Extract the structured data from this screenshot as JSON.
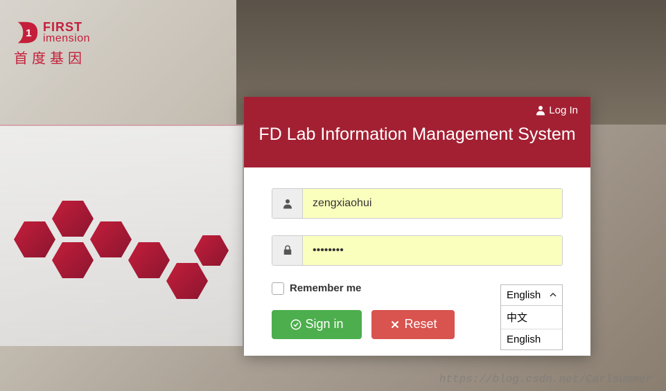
{
  "logo": {
    "line1": "FIRST",
    "line2": "imension",
    "chinese": "首度基因"
  },
  "header": {
    "login_label": "Log In",
    "title": "FD Lab Information Management System"
  },
  "form": {
    "username_value": "zengxiaohui",
    "password_value": "••••••••",
    "remember_label": "Remember me",
    "signin_label": "Sign in",
    "reset_label": "Reset"
  },
  "language": {
    "selected": "English",
    "options": [
      "中文",
      "English"
    ]
  },
  "watermark": "https://blog.csdn.net/Carlsummer"
}
